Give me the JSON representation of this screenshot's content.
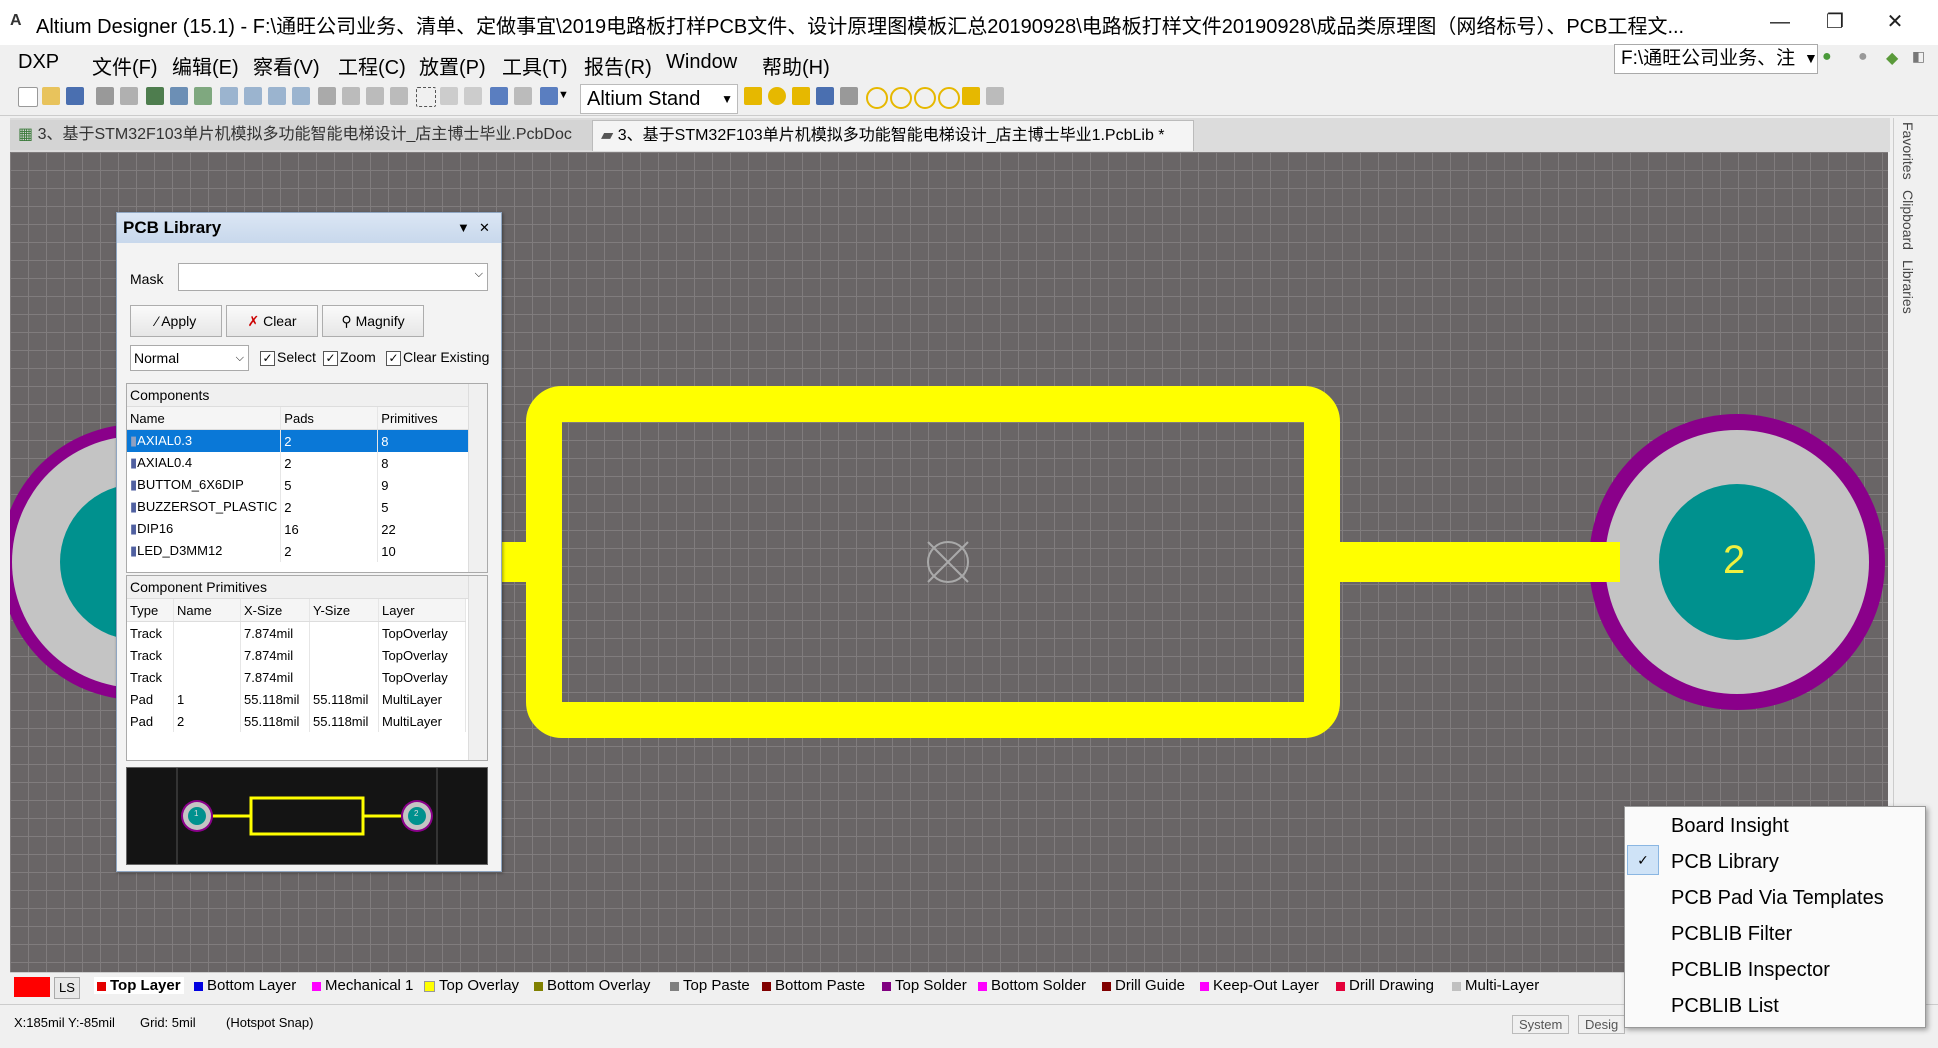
{
  "window": {
    "title": "Altium Designer (15.1) - F:\\通旺公司业务、清单、定做事宜\\2019电路板打样PCB文件、设计原理图模板汇总20190928\\电路板打样文件20190928\\成品类原理图（网络标号）、PCB工程文...",
    "minimize": "—",
    "restore": "❐",
    "close": "✕"
  },
  "menu": {
    "items": [
      "DXP",
      "文件(F)",
      "编辑(E)",
      "察看(V)",
      "工程(C)",
      "放置(P)",
      "工具(T)",
      "报告(R)",
      "Window",
      "帮助(H)"
    ],
    "path": "F:\\通旺公司业务、注"
  },
  "toolbar": {
    "style_combo": "Altium Stand"
  },
  "tabs": [
    {
      "label": "3、基于STM32F103单片机模拟多功能智能电梯设计_店主博士毕业.PcbDoc",
      "active": false
    },
    {
      "label": "3、基于STM32F103单片机模拟多功能智能电梯设计_店主博士毕业1.PcbLib *",
      "active": true
    }
  ],
  "right_panels": [
    "Favorites",
    "Clipboard",
    "Libraries"
  ],
  "panel": {
    "title": "PCB Library",
    "mask_label": "Mask",
    "mask_value": "",
    "apply": "Apply",
    "clear": "Clear",
    "magnify": "Magnify",
    "mode": "Normal",
    "select": "Select",
    "zoom": "Zoom",
    "clear_existing": "Clear Existing",
    "components": {
      "header": "Components",
      "columns": [
        "Name",
        "Pads",
        "Primitives"
      ],
      "rows": [
        [
          "AXIAL0.3",
          "2",
          "8"
        ],
        [
          "AXIAL0.4",
          "2",
          "8"
        ],
        [
          "BUTTOM_6X6DIP",
          "5",
          "9"
        ],
        [
          "BUZZERSOT_PLASTIC",
          "2",
          "5"
        ],
        [
          "DIP16",
          "16",
          "22"
        ],
        [
          "LED_D3MM12",
          "2",
          "10"
        ]
      ],
      "selected": 0
    },
    "primitives": {
      "header": "Component Primitives",
      "columns": [
        "Type",
        "Name",
        "X-Size",
        "Y-Size",
        "Layer"
      ],
      "rows": [
        [
          "Track",
          "",
          "7.874mil",
          "",
          "TopOverlay"
        ],
        [
          "Track",
          "",
          "7.874mil",
          "",
          "TopOverlay"
        ],
        [
          "Track",
          "",
          "7.874mil",
          "",
          "TopOverlay"
        ],
        [
          "Pad",
          "1",
          "55.118mil",
          "55.118mil",
          "MultiLayer"
        ],
        [
          "Pad",
          "2",
          "55.118mil",
          "55.118mil",
          "MultiLayer"
        ]
      ]
    }
  },
  "canvas": {
    "pad_label": "2",
    "preview_pad1": "1",
    "preview_pad2": "2"
  },
  "layers": {
    "current": "LS",
    "tabs": [
      {
        "label": "Top Layer",
        "color": "#e40000"
      },
      {
        "label": "Bottom Layer",
        "color": "#0000e0"
      },
      {
        "label": "Mechanical 1",
        "color": "#ff00ff"
      },
      {
        "label": "Top Overlay",
        "color": "#ffff00"
      },
      {
        "label": "Bottom Overlay",
        "color": "#808000"
      },
      {
        "label": "Top Paste",
        "color": "#808080"
      },
      {
        "label": "Bottom Paste",
        "color": "#800000"
      },
      {
        "label": "Top Solder",
        "color": "#800080"
      },
      {
        "label": "Bottom Solder",
        "color": "#ff00ff"
      },
      {
        "label": "Drill Guide",
        "color": "#800000"
      },
      {
        "label": "Keep-Out Layer",
        "color": "#ff00ff"
      },
      {
        "label": "Drill Drawing",
        "color": "#e4003a"
      },
      {
        "label": "Multi-Layer",
        "color": "#c0c0c0"
      }
    ]
  },
  "status": {
    "coords": "X:185mil Y:-85mil",
    "grid": "Grid: 5mil",
    "snap": "(Hotspot Snap)",
    "system": "System",
    "design": "Desig"
  },
  "popup": {
    "items": [
      "Board Insight",
      "PCB Library",
      "PCB Pad Via Templates",
      "PCBLIB Filter",
      "PCBLIB Inspector",
      "PCBLIB List"
    ],
    "checked": 1
  },
  "colors": {
    "overlay": "#ffff00",
    "pad": "#00918e",
    "pad_ring": "#c4c4c4",
    "solder": "#8a008a",
    "canvas": "#696566"
  }
}
